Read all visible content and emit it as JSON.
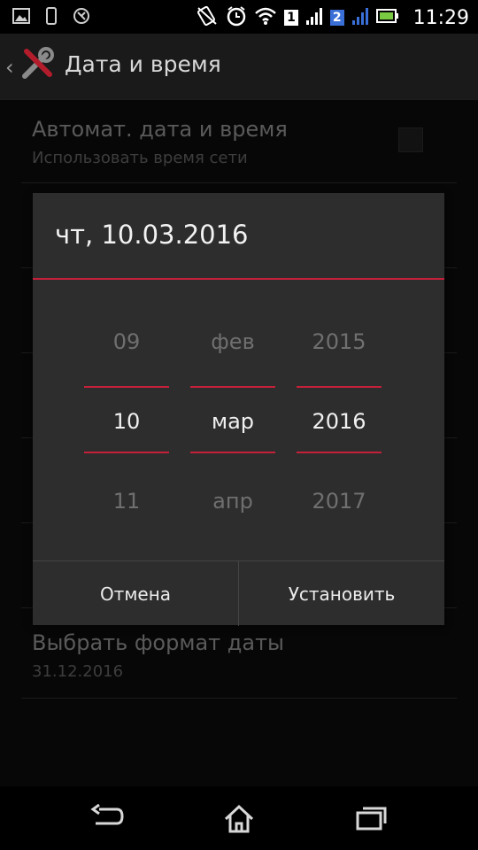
{
  "status_bar": {
    "time": "11:29",
    "sim1_label": "1",
    "sim2_label": "2",
    "icons": [
      "gallery-icon",
      "phone-icon",
      "app-icon",
      "mute-icon",
      "alarm-icon",
      "wifi-icon",
      "signal-icon",
      "battery-icon"
    ]
  },
  "action_bar": {
    "title": "Дата и время",
    "icon": "tools-icon"
  },
  "settings": {
    "auto_datetime": {
      "title": "Автомат. дата и время",
      "subtitle": "Использовать время сети"
    },
    "date_format": {
      "title": "Выбрать формат даты",
      "subtitle": "31.12.2016"
    }
  },
  "dialog": {
    "title": "чт, 10.03.2016",
    "day": {
      "prev": "09",
      "current": "10",
      "next": "11"
    },
    "month": {
      "prev": "фев",
      "current": "мар",
      "next": "апр"
    },
    "year": {
      "prev": "2015",
      "current": "2016",
      "next": "2017"
    },
    "cancel_label": "Отмена",
    "set_label": "Установить"
  },
  "nav_bar": {
    "icons": [
      "back-icon",
      "home-icon",
      "recents-icon"
    ]
  },
  "colors": {
    "accent": "#c4203a",
    "dialog_bg": "#2d2d2d",
    "background": "#0b0b0b"
  }
}
